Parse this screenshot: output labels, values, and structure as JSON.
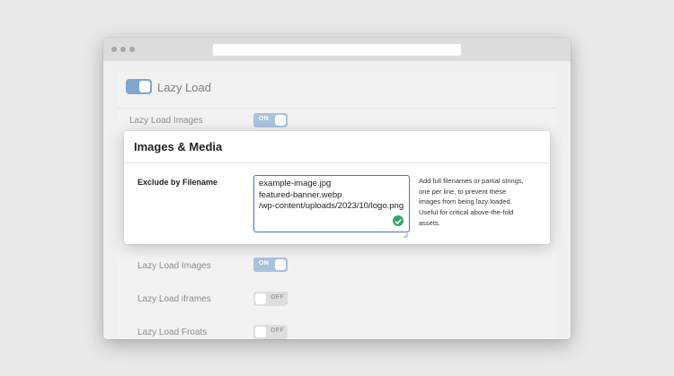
{
  "settings": {
    "section_title": "Lazy Load",
    "rows": [
      {
        "label": "Lazy Load Images",
        "state": "ON"
      },
      {
        "label": "Lazy Load Images",
        "state": "ON"
      },
      {
        "label": "Lazy Load iframes",
        "state": "OFF"
      },
      {
        "label": "Lazy Load Froats",
        "state": "OFF"
      }
    ]
  },
  "modal": {
    "title": "Images & Media",
    "field_label": "Exclude by Filename",
    "textarea_lines": [
      "example-image.jpg",
      "featured-banner.webp",
      "/wp-content/uploads/2023/10/logo.png"
    ],
    "help_lines": [
      "Add full filenames or partial strings,",
      "one per line, to prevent these",
      "images from being lazy loaded.",
      "Useful for critical above-the-fold",
      "assets."
    ]
  },
  "colors": {
    "accent": "#3d7ab8",
    "toggle_on": "#a9c3dd",
    "valid_check": "#35a46a"
  }
}
